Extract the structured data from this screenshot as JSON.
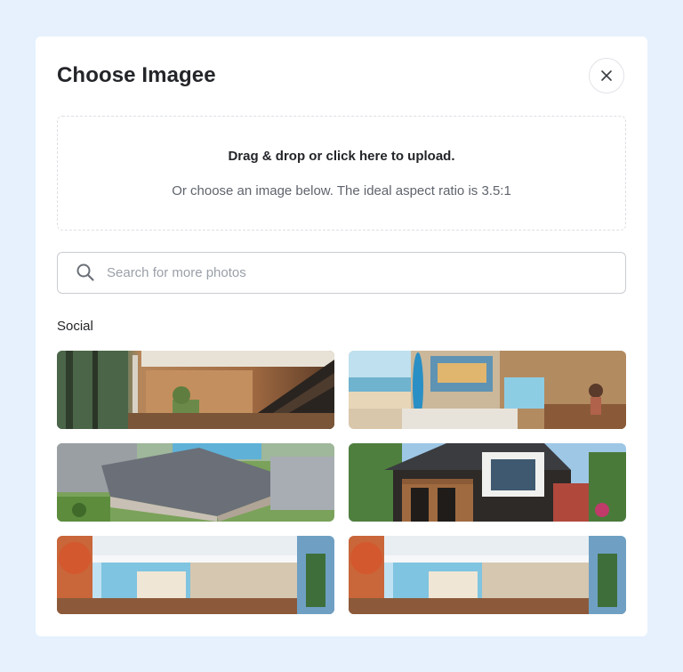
{
  "modal": {
    "title": "Choose Imagee",
    "close_icon": "close-icon"
  },
  "dropzone": {
    "primary": "Drag & drop or click here to upload.",
    "secondary": "Or choose an image below. The ideal aspect ratio is 3.5:1"
  },
  "search": {
    "placeholder": "Search for more photos",
    "value": "",
    "icon": "search-icon"
  },
  "gallery": {
    "section_label": "Social",
    "images": [
      {
        "subject": "modern interior with staircase"
      },
      {
        "subject": "beach house living room with surfboard"
      },
      {
        "subject": "aerial view of residential building"
      },
      {
        "subject": "modern house exterior with balcony"
      },
      {
        "subject": "white villa with pool"
      },
      {
        "subject": "white villa with pool"
      }
    ]
  },
  "colors": {
    "page_background": "#e6f1fd",
    "modal_background": "#ffffff",
    "text_primary": "#232529",
    "text_secondary": "#5f646c",
    "placeholder": "#9aa0a8",
    "border": "#c9cdd3"
  }
}
